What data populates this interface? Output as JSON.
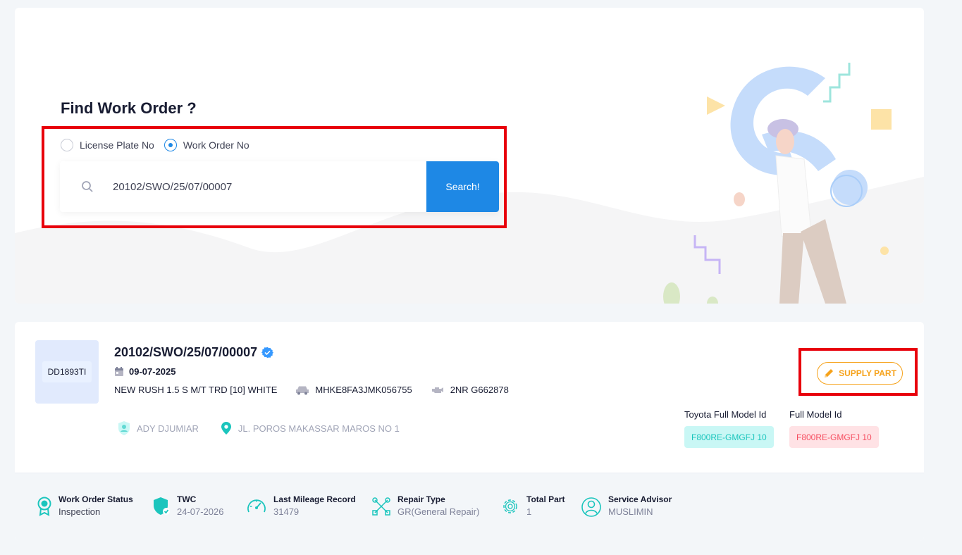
{
  "search": {
    "title": "Find Work Order ?",
    "radio_options": [
      "License Plate No",
      "Work Order No"
    ],
    "selected_option": "Work Order No",
    "input_value": "20102/SWO/25/07/00007",
    "button_label": "Search!"
  },
  "work_order": {
    "plate": "DD1893TI",
    "number": "20102/SWO/25/07/00007",
    "date": "09-07-2025",
    "vehicle_model": "NEW RUSH 1.5 S M/T TRD [10] WHITE",
    "vin": "MHKE8FA3JMK056755",
    "engine": "2NR G662878",
    "customer": "ADY DJUMIAR",
    "address": "JL. POROS MAKASSAR MAROS NO 1",
    "supply_button": "SUPPLY PART",
    "toyota_model_label": "Toyota Full Model Id",
    "toyota_model_value": "F800RE-GMGFJ 10",
    "full_model_label": "Full Model Id",
    "full_model_value": "F800RE-GMGFJ 10"
  },
  "stats": [
    {
      "label": "Work Order Status",
      "value": "Inspection",
      "icon": "badge-icon"
    },
    {
      "label": "TWC",
      "value": "24-07-2026",
      "icon": "shield-check-icon"
    },
    {
      "label": "Last Mileage Record",
      "value": "31479",
      "icon": "speedometer-icon"
    },
    {
      "label": "Repair Type",
      "value": "GR(General Repair)",
      "icon": "tools-icon"
    },
    {
      "label": "Total Part",
      "value": "1",
      "icon": "gear-icon"
    },
    {
      "label": "Service Advisor",
      "value": "MUSLIMIN",
      "icon": "user-circle-icon"
    }
  ],
  "colors": {
    "primary": "#1e88e5",
    "highlight": "#e8000b",
    "warning": "#f6a21a",
    "teal": "#1bc5bd",
    "danger": "#f64e60"
  }
}
